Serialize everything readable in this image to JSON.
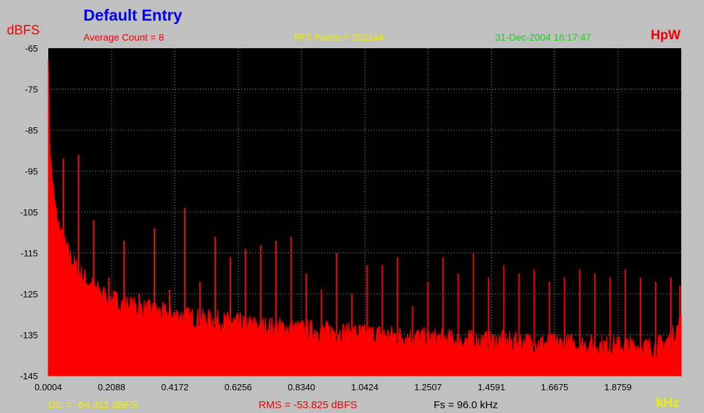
{
  "header": {
    "title": "Default Entry",
    "y_unit_label": "dBFS",
    "brand": "HpW",
    "average_count": "Average Count = 8",
    "fft_points": "FFT Points = 262144",
    "timestamp": "31-Dec-2004 16:17:47"
  },
  "footer": {
    "dc": "DC = -64.311 dBFS",
    "rms": "RMS = -53.825 dBFS",
    "fs": "Fs = 96.0 kHz",
    "x_unit_label": "kHz"
  },
  "colors": {
    "background": "#c0c0c0",
    "plot_background": "#000000",
    "trace": "#ff0000",
    "grid": "#9a9a9a"
  },
  "chart_data": {
    "type": "area",
    "title": "Default Entry",
    "xlabel": "kHz",
    "ylabel": "dBFS",
    "xlim": [
      0.0004,
      2.0843
    ],
    "ylim": [
      -145,
      -65
    ],
    "x_tick_labels": [
      "0.0004",
      "0.2088",
      "0.4172",
      "0.6256",
      "0.8340",
      "1.0424",
      "1.2507",
      "1.4591",
      "1.6675",
      "1.8759"
    ],
    "y_tick_labels": [
      "-65",
      "-75",
      "-85",
      "-95",
      "-105",
      "-115",
      "-125",
      "-135",
      "-145"
    ],
    "grid": true,
    "series": [
      {
        "noise_floor": {
          "x": [
            0.0004,
            0.005,
            0.01,
            0.02,
            0.03,
            0.045,
            0.06,
            0.08,
            0.1,
            0.13,
            0.16,
            0.2,
            0.25,
            0.3,
            0.4,
            0.5,
            0.6,
            0.7,
            0.8,
            0.9,
            1.0,
            1.1,
            1.2,
            1.3,
            1.4,
            1.5,
            1.6,
            1.7,
            1.8,
            1.9,
            2.0,
            2.05,
            2.0843
          ],
          "y": [
            -66,
            -88,
            -95,
            -103,
            -108,
            -112,
            -115,
            -118,
            -120.5,
            -123,
            -125,
            -127,
            -128.5,
            -129.5,
            -131,
            -132,
            -133,
            -133.8,
            -134.5,
            -135,
            -135.5,
            -136,
            -136.5,
            -137,
            -137.3,
            -137.6,
            -137.9,
            -138.2,
            -138.5,
            -138.7,
            -139,
            -137,
            -133
          ]
        },
        "spikes": {
          "x": [
            0.05,
            0.1,
            0.15,
            0.2,
            0.25,
            0.3,
            0.35,
            0.4,
            0.45,
            0.5,
            0.55,
            0.6,
            0.65,
            0.7,
            0.75,
            0.8,
            0.85,
            0.9,
            0.95,
            1.0,
            1.05,
            1.1,
            1.15,
            1.2,
            1.25,
            1.3,
            1.35,
            1.4,
            1.45,
            1.5,
            1.55,
            1.6,
            1.65,
            1.7,
            1.75,
            1.8,
            1.85,
            1.9,
            1.95,
            2.0,
            2.05,
            2.08
          ],
          "y": [
            -92,
            -91,
            -107,
            -121,
            -112,
            -125,
            -109,
            -124,
            -104,
            -122,
            -111,
            -116,
            -114,
            -113,
            -112,
            -111,
            -120,
            -124,
            -115,
            -125,
            -118,
            -118,
            -116,
            -128,
            -122,
            -116,
            -120,
            -115,
            -121,
            -118,
            -120,
            -119,
            -122,
            -121,
            -119,
            -120,
            -121,
            -119,
            -121,
            -122,
            -121,
            -123
          ]
        }
      }
    ]
  }
}
